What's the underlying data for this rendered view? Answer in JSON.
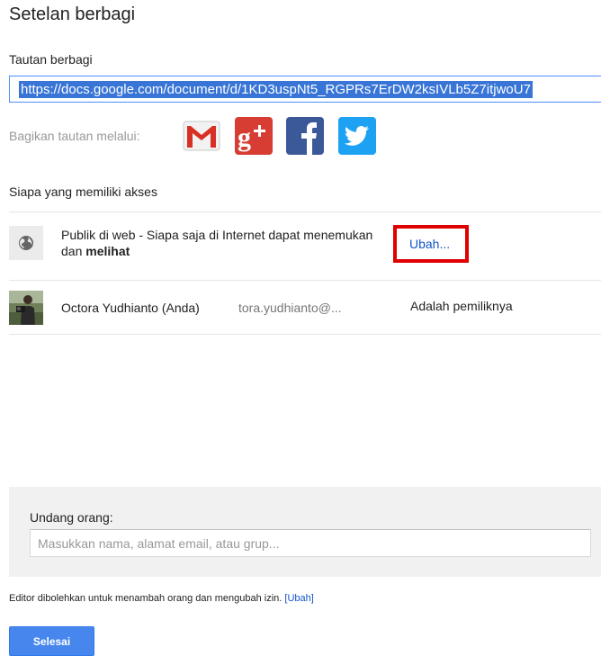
{
  "dialog": {
    "title": "Setelan berbagi"
  },
  "share_link": {
    "label": "Tautan berbagi",
    "url": "https://docs.google.com/document/d/1KD3uspNt5_RGPRs7ErDW2ksIVLb5Z7itjwoU7"
  },
  "share_via": {
    "label": "Bagikan tautan melalui:",
    "services": [
      {
        "name": "Gmail",
        "icon": "gmail-icon",
        "color": "#dd4b39"
      },
      {
        "name": "Google+",
        "icon": "google-plus-icon",
        "color": "#dd4b39"
      },
      {
        "name": "Facebook",
        "icon": "facebook-icon",
        "color": "#3b5998"
      },
      {
        "name": "Twitter",
        "icon": "twitter-icon",
        "color": "#1da1f2"
      }
    ]
  },
  "access": {
    "label": "Siapa yang memiliki akses",
    "public": {
      "icon": "globe-icon",
      "text_prefix": "Publik di web - Siapa saja di Internet dapat menemukan dan ",
      "text_bold": "melihat",
      "change_link": "Ubah..."
    },
    "owner": {
      "name": "Octora Yudhianto (Anda)",
      "email": "tora.yudhianto@...",
      "role": "Adalah pemiliknya"
    }
  },
  "invite": {
    "label": "Undang orang:",
    "placeholder": "Masukkan nama, alamat email, atau grup..."
  },
  "footer": {
    "note": "Editor dibolehkan untuk menambah orang dan mengubah izin.",
    "change_link": "[Ubah]"
  },
  "done_button": {
    "label": "Selesai"
  },
  "colors": {
    "link": "#1155cc",
    "highlight": "#3875d7",
    "button": "#4787ed",
    "emphasis_border": "#e00000"
  }
}
